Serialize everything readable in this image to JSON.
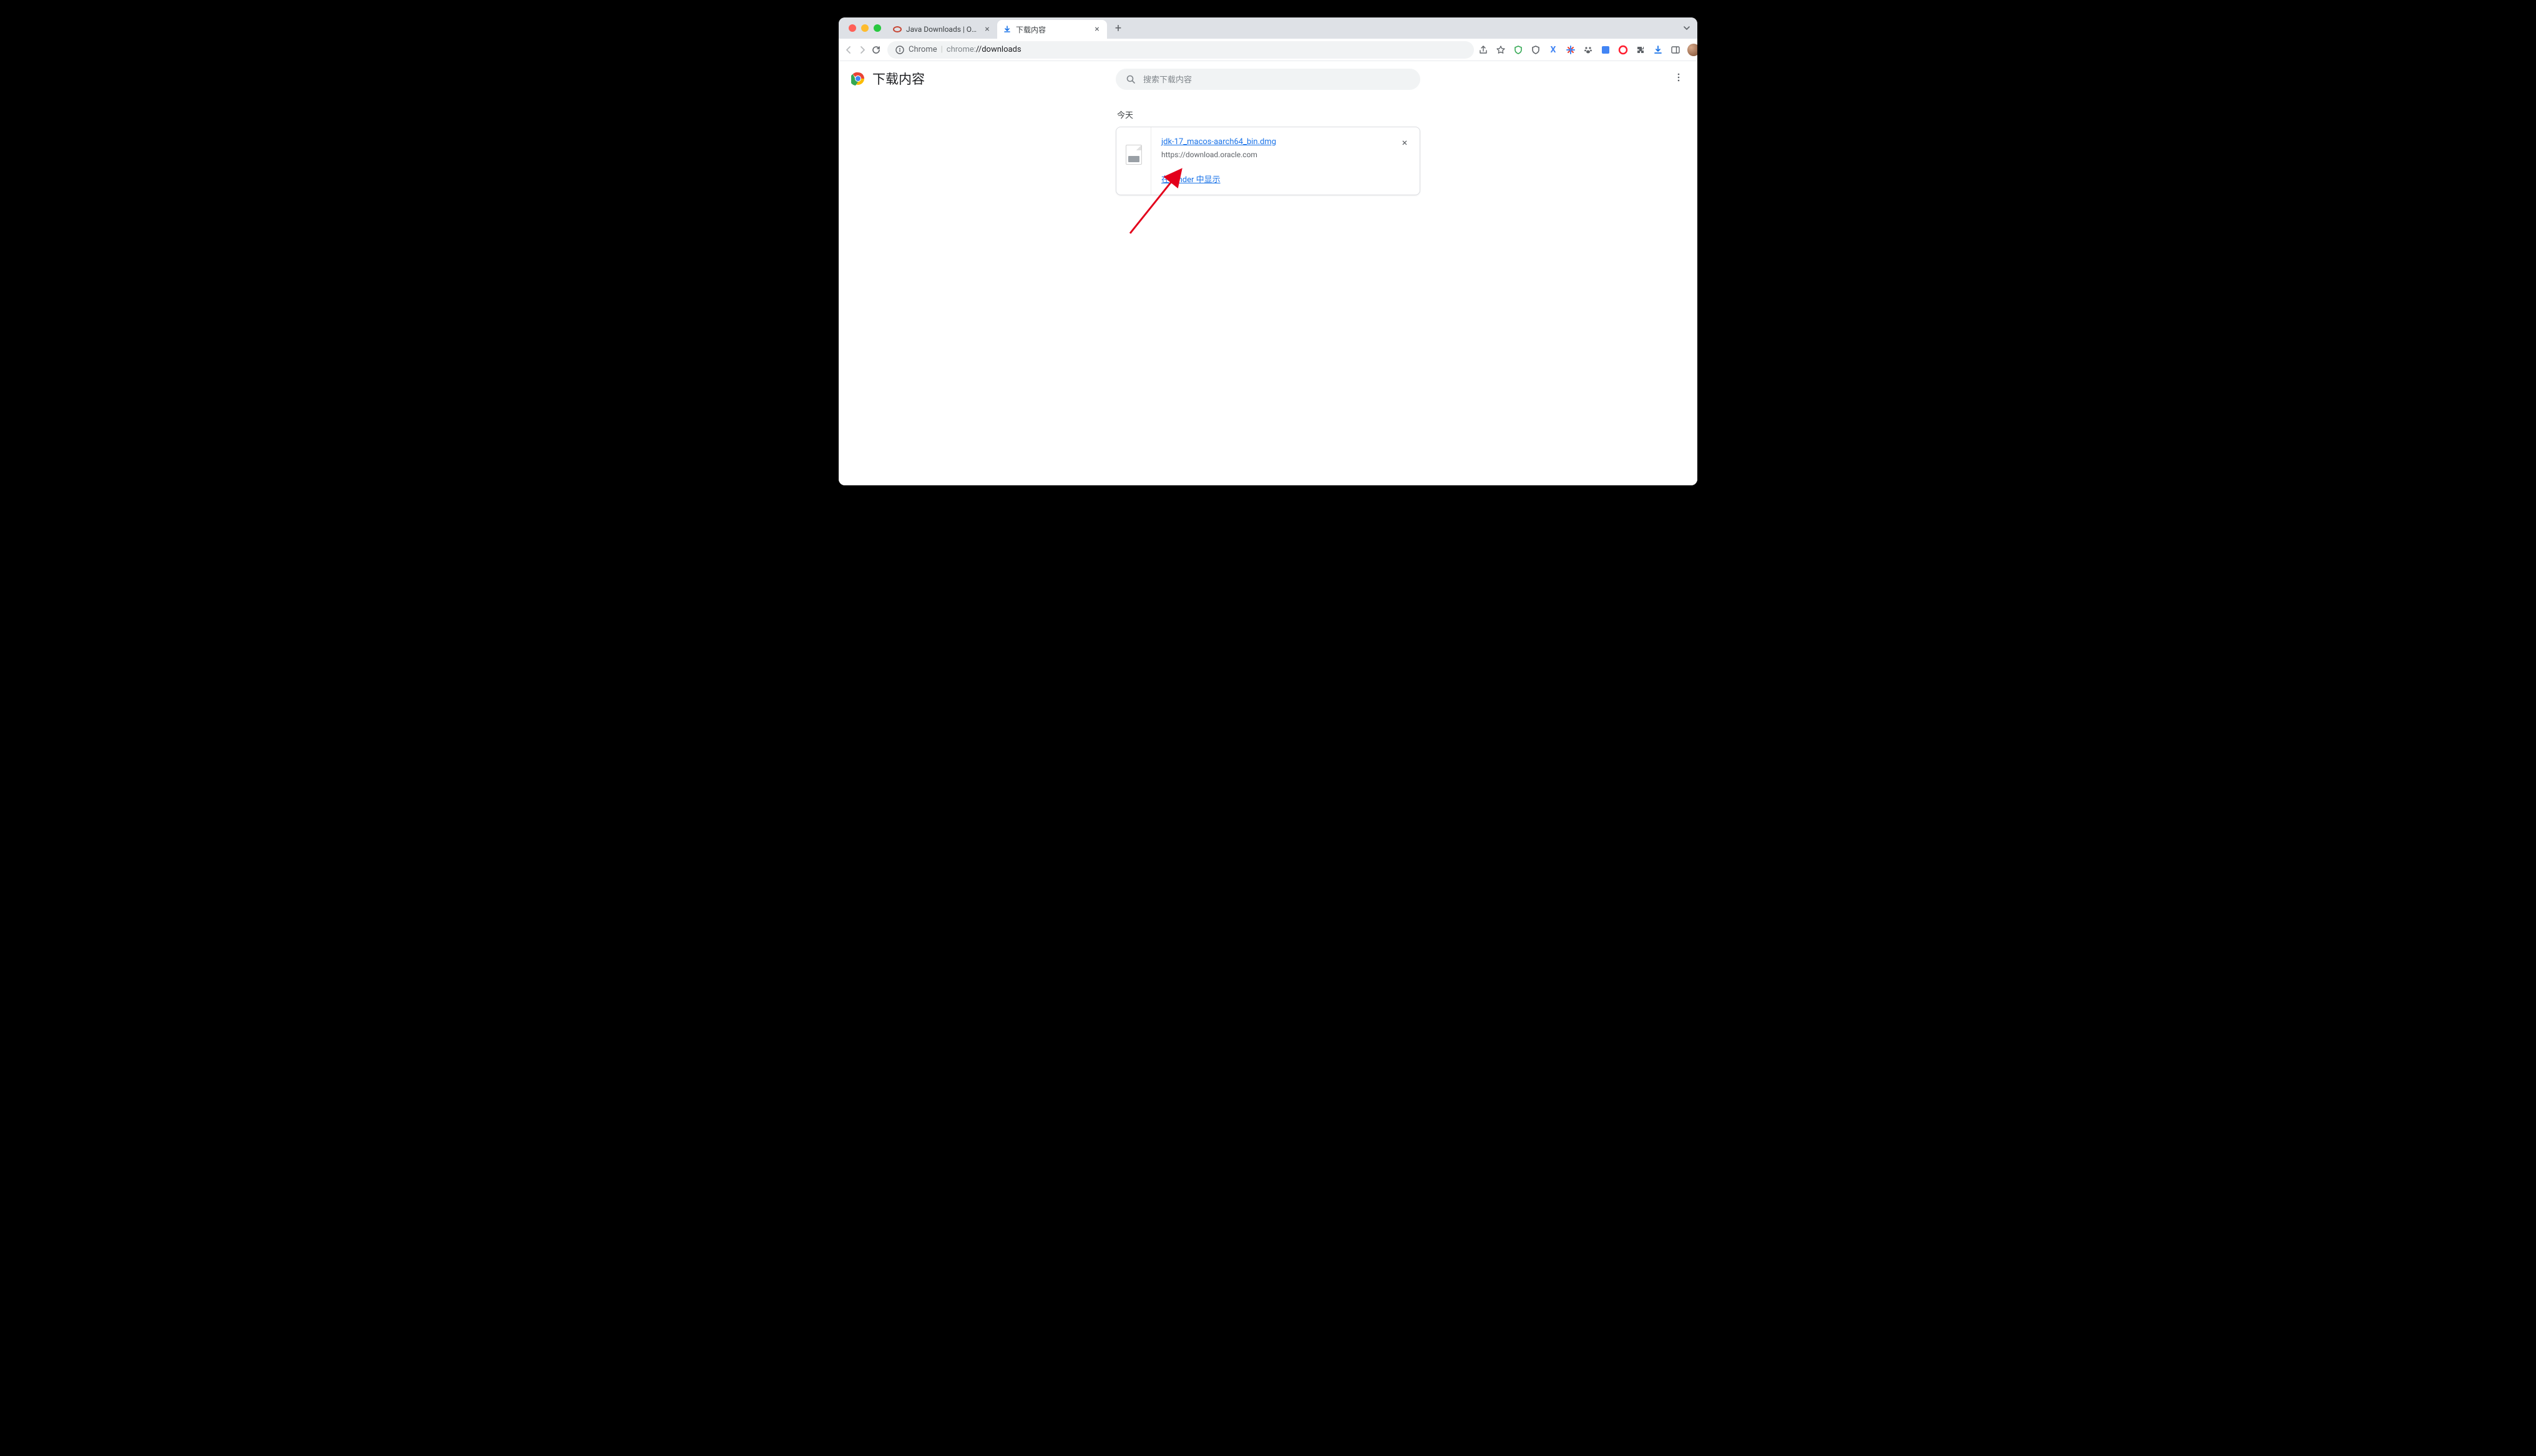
{
  "tabs": [
    {
      "title": "Java Downloads | Oracle",
      "favicon": "oracle"
    },
    {
      "title": "下载内容",
      "favicon": "download"
    }
  ],
  "omnibox": {
    "scheme_label": "Chrome",
    "url_dim": "chrome:",
    "url_bold": "//downloads"
  },
  "page": {
    "title": "下载内容",
    "search_placeholder": "搜索下载内容",
    "section_today": "今天"
  },
  "download": {
    "filename": "jdk-17_macos-aarch64_bin.dmg",
    "source": "https://download.oracle.com",
    "show_in_finder": "在 Finder 中显示"
  }
}
